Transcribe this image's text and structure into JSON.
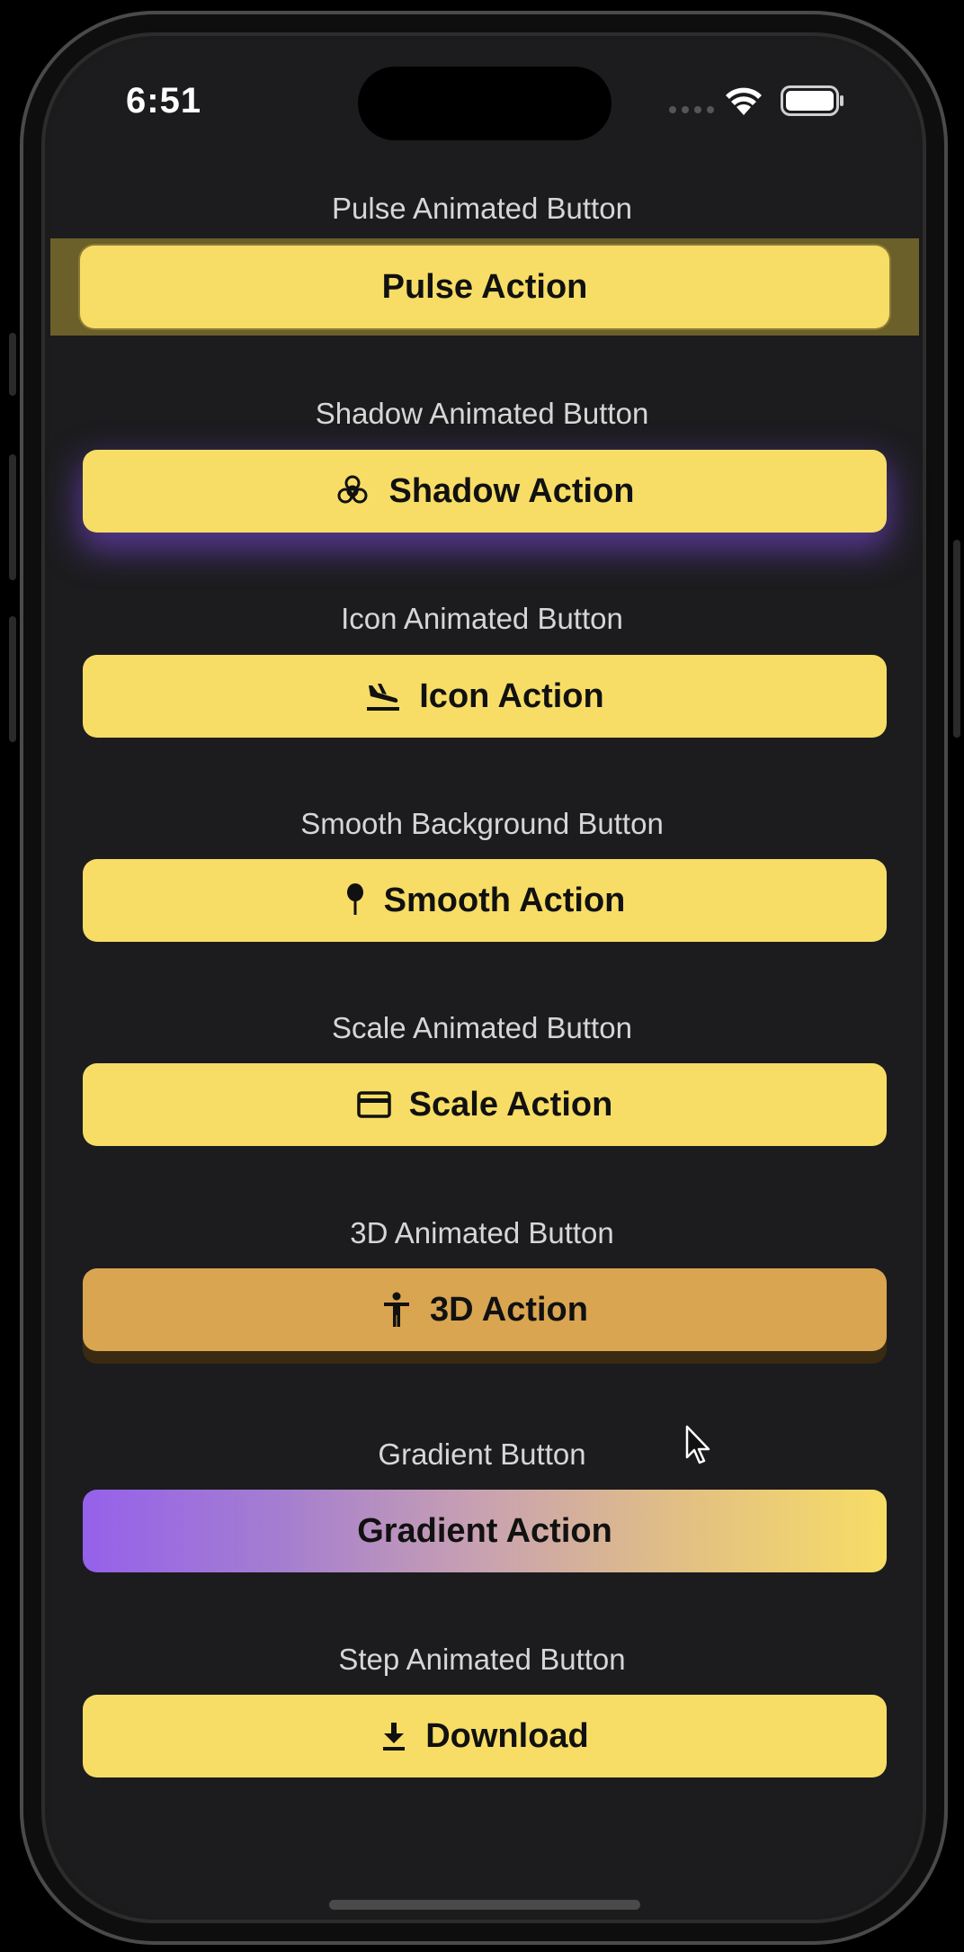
{
  "status_bar": {
    "time": "6:51"
  },
  "sections": [
    {
      "label": "Pulse Animated Button",
      "button": "Pulse Action"
    },
    {
      "label": "Shadow Animated Button",
      "button": "Shadow Action",
      "icon": "biohazard-icon"
    },
    {
      "label": "Icon Animated Button",
      "button": "Icon Action",
      "icon": "flight-land-icon"
    },
    {
      "label": "Smooth Background Button",
      "button": "Smooth Action",
      "icon": "pin-icon"
    },
    {
      "label": "Scale Animated Button",
      "button": "Scale Action",
      "icon": "credit-card-icon"
    },
    {
      "label": "3D Animated Button",
      "button": "3D Action",
      "icon": "person-icon"
    },
    {
      "label": "Gradient Button",
      "button": "Gradient Action"
    },
    {
      "label": "Step Animated Button",
      "button": "Download",
      "icon": "download-icon"
    }
  ],
  "colors": {
    "button_yellow": "#f7dd66",
    "button_3d": "#d9a550",
    "gradient_start": "#9561ea",
    "gradient_end": "#f7dd66",
    "shadow_glow": "#6a42b8",
    "background": "#1c1c1e"
  }
}
